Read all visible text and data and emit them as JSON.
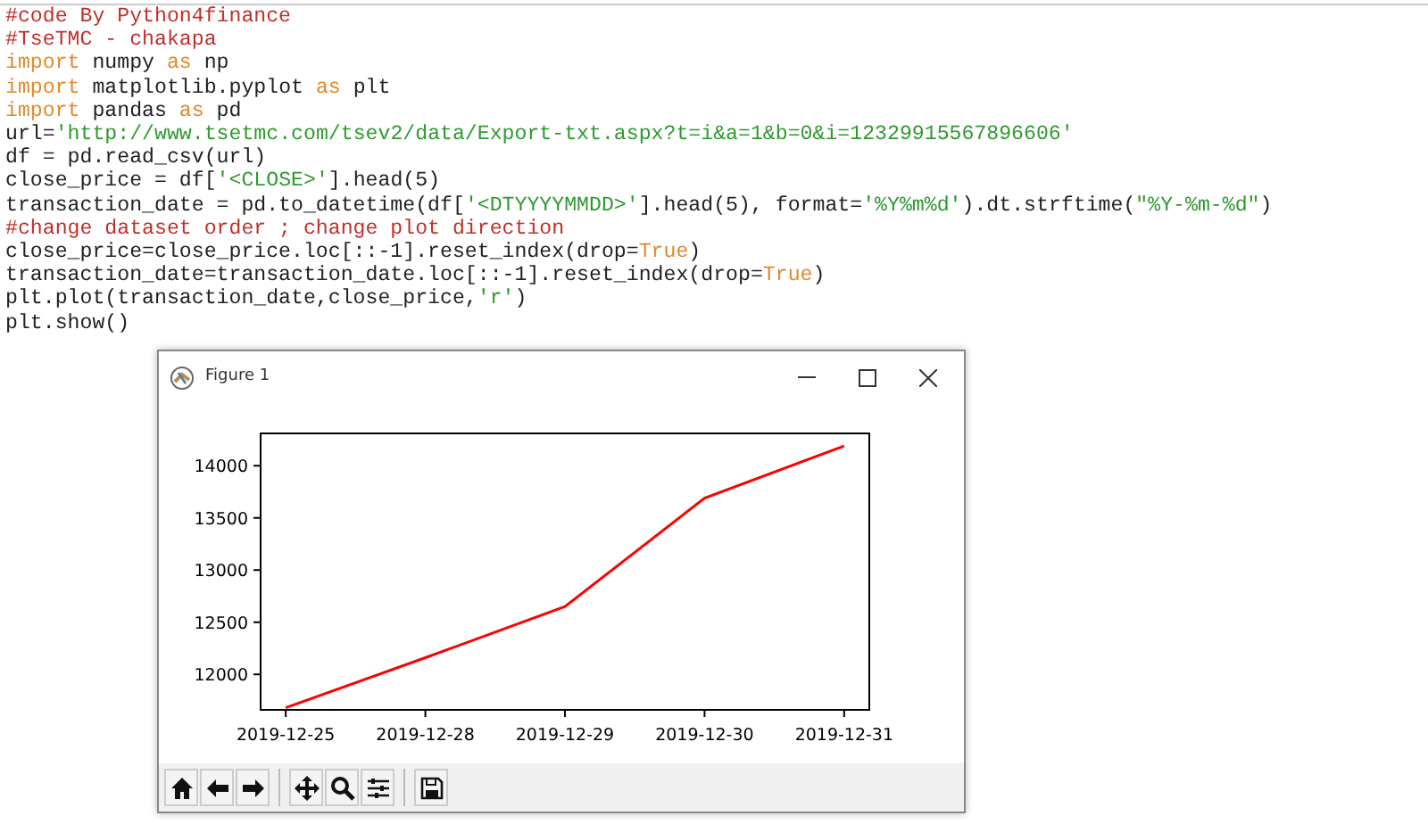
{
  "editor": {
    "lines": [
      [
        {
          "kind": "comment",
          "text": "#code By Python4finance"
        }
      ],
      [
        {
          "kind": "comment",
          "text": "#TseTMC - chakapa"
        }
      ],
      [
        {
          "kind": "keyword",
          "text": "import"
        },
        {
          "kind": "plain",
          "text": " numpy "
        },
        {
          "kind": "keyword",
          "text": "as"
        },
        {
          "kind": "plain",
          "text": " np"
        }
      ],
      [
        {
          "kind": "keyword",
          "text": "import"
        },
        {
          "kind": "plain",
          "text": " matplotlib.pyplot "
        },
        {
          "kind": "keyword",
          "text": "as"
        },
        {
          "kind": "plain",
          "text": " plt"
        }
      ],
      [
        {
          "kind": "keyword",
          "text": "import"
        },
        {
          "kind": "plain",
          "text": " pandas "
        },
        {
          "kind": "keyword",
          "text": "as"
        },
        {
          "kind": "plain",
          "text": " pd"
        }
      ],
      [
        {
          "kind": "plain",
          "text": "url="
        },
        {
          "kind": "string",
          "text": "'http://www.tsetmc.com/tsev2/data/Export-txt.aspx?t=i&a=1&b=0&i=12329915567896606'"
        }
      ],
      [
        {
          "kind": "plain",
          "text": "df = pd.read_csv(url)"
        }
      ],
      [
        {
          "kind": "plain",
          "text": "close_price = df["
        },
        {
          "kind": "string",
          "text": "'<CLOSE>'"
        },
        {
          "kind": "plain",
          "text": "].head(5)"
        }
      ],
      [
        {
          "kind": "plain",
          "text": "transaction_date = pd.to_datetime(df["
        },
        {
          "kind": "string",
          "text": "'<DTYYYYMMDD>'"
        },
        {
          "kind": "plain",
          "text": "].head(5), format="
        },
        {
          "kind": "string",
          "text": "'%Y%m%d'"
        },
        {
          "kind": "plain",
          "text": ").dt.strftime("
        },
        {
          "kind": "string",
          "text": "\"%Y-%m-%d\""
        },
        {
          "kind": "plain",
          "text": ")"
        }
      ],
      [
        {
          "kind": "comment",
          "text": "#change dataset order ; change plot direction"
        }
      ],
      [
        {
          "kind": "plain",
          "text": "close_price=close_price.loc[::-1].reset_index(drop="
        },
        {
          "kind": "keyword",
          "text": "True"
        },
        {
          "kind": "plain",
          "text": ")"
        }
      ],
      [
        {
          "kind": "plain",
          "text": "transaction_date=transaction_date.loc[::-1].reset_index(drop="
        },
        {
          "kind": "keyword",
          "text": "True"
        },
        {
          "kind": "plain",
          "text": ")"
        }
      ],
      [
        {
          "kind": "plain",
          "text": "plt.plot(transaction_date,close_price,"
        },
        {
          "kind": "string",
          "text": "'r'"
        },
        {
          "kind": "plain",
          "text": ")"
        }
      ],
      [
        {
          "kind": "plain",
          "text": "plt.show()"
        }
      ]
    ]
  },
  "figure_window": {
    "title": "Figure 1",
    "chart_data": {
      "type": "line",
      "categories": [
        "2019-12-25",
        "2019-12-28",
        "2019-12-29",
        "2019-12-30",
        "2019-12-31"
      ],
      "series": [
        {
          "color": "#ff0000",
          "values": [
            11680,
            12160,
            12650,
            13690,
            14190
          ]
        }
      ],
      "ylim": [
        11660,
        14310
      ],
      "yticks": [
        12000,
        12500,
        13000,
        13500,
        14000
      ]
    },
    "toolbar": [
      {
        "kind": "home"
      },
      {
        "kind": "back"
      },
      {
        "kind": "forward"
      },
      {
        "kind": "sep"
      },
      {
        "kind": "pan"
      },
      {
        "kind": "zoom"
      },
      {
        "kind": "configure"
      },
      {
        "kind": "sep"
      },
      {
        "kind": "save"
      }
    ]
  }
}
